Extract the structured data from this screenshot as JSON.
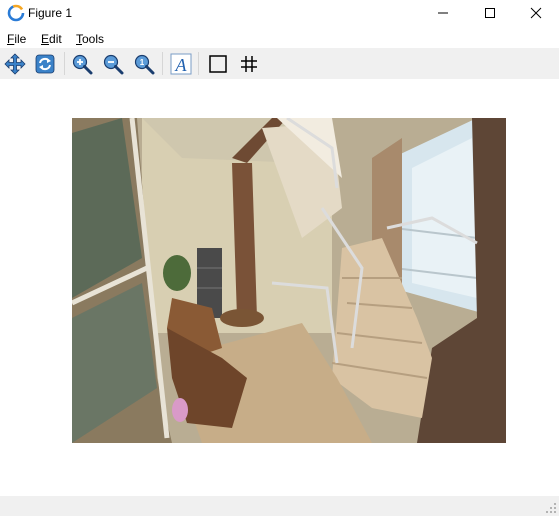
{
  "window": {
    "title": "Figure 1",
    "minimize_icon": "minimize-icon",
    "maximize_icon": "maximize-icon",
    "close_icon": "close-icon"
  },
  "menu": {
    "items": [
      {
        "label_first": "F",
        "label_rest": "ile"
      },
      {
        "label_first": "E",
        "label_rest": "dit"
      },
      {
        "label_first": "T",
        "label_rest": "ools"
      }
    ]
  },
  "toolbar": {
    "buttons": [
      {
        "icon": "pan-icon"
      },
      {
        "icon": "rotate-icon"
      },
      {
        "icon": "zoom-in-icon"
      },
      {
        "icon": "zoom-out-icon"
      },
      {
        "icon": "zoom-fit-icon"
      },
      {
        "icon": "text-icon"
      },
      {
        "icon": "rectangle-icon"
      },
      {
        "icon": "grid-icon"
      }
    ]
  },
  "canvas": {
    "image": "staircase-room-photo"
  },
  "colors": {
    "toolbar_bg": "#f0f0f0",
    "icon_blue": "#2f6fb8",
    "icon_outline": "#1a3d6e"
  }
}
